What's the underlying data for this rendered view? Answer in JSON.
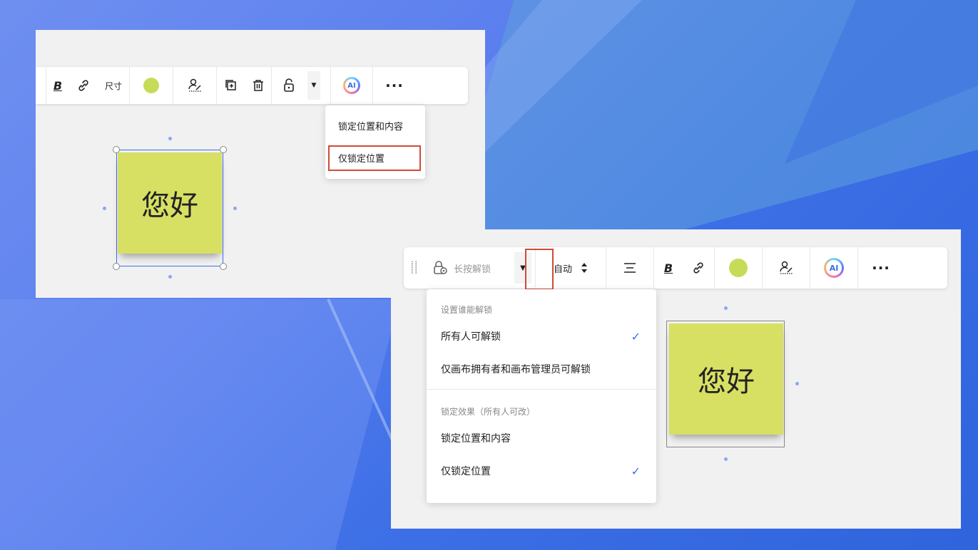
{
  "panel_a": {
    "toolbar": {
      "size_label": "尺寸"
    },
    "menu": {
      "items": [
        {
          "label": "锁定位置和内容"
        },
        {
          "label": "仅锁定位置"
        }
      ]
    },
    "note_text": "您好"
  },
  "panel_b": {
    "toolbar": {
      "unlock_label": "长按解锁",
      "auto_label": "自动"
    },
    "menu": {
      "section1_title": "设置谁能解锁",
      "option_everyone": "所有人可解锁",
      "option_owners": "仅画布拥有者和画布管理员可解锁",
      "section2_title": "锁定效果（所有人可改）",
      "option_lock_all": "锁定位置和内容",
      "option_lock_position": "仅锁定位置",
      "check_mark": "✓"
    },
    "note_text": "您好"
  },
  "colors": {
    "note": "#d7e063",
    "accent": "#3d6fe6",
    "highlight": "#d04a3a",
    "sticky_color_dot": "#c6dc58"
  },
  "icons": [
    "bold-icon",
    "link-icon",
    "color-icon",
    "shape-edit-icon",
    "duplicate-icon",
    "delete-icon",
    "unlock-icon",
    "chevron-down-icon",
    "ai-icon",
    "more-icon",
    "drag-grip-icon",
    "lock-location-icon",
    "updown-arrow-icon",
    "align-center-icon"
  ],
  "ai_label": "AI",
  "more_label": "···"
}
